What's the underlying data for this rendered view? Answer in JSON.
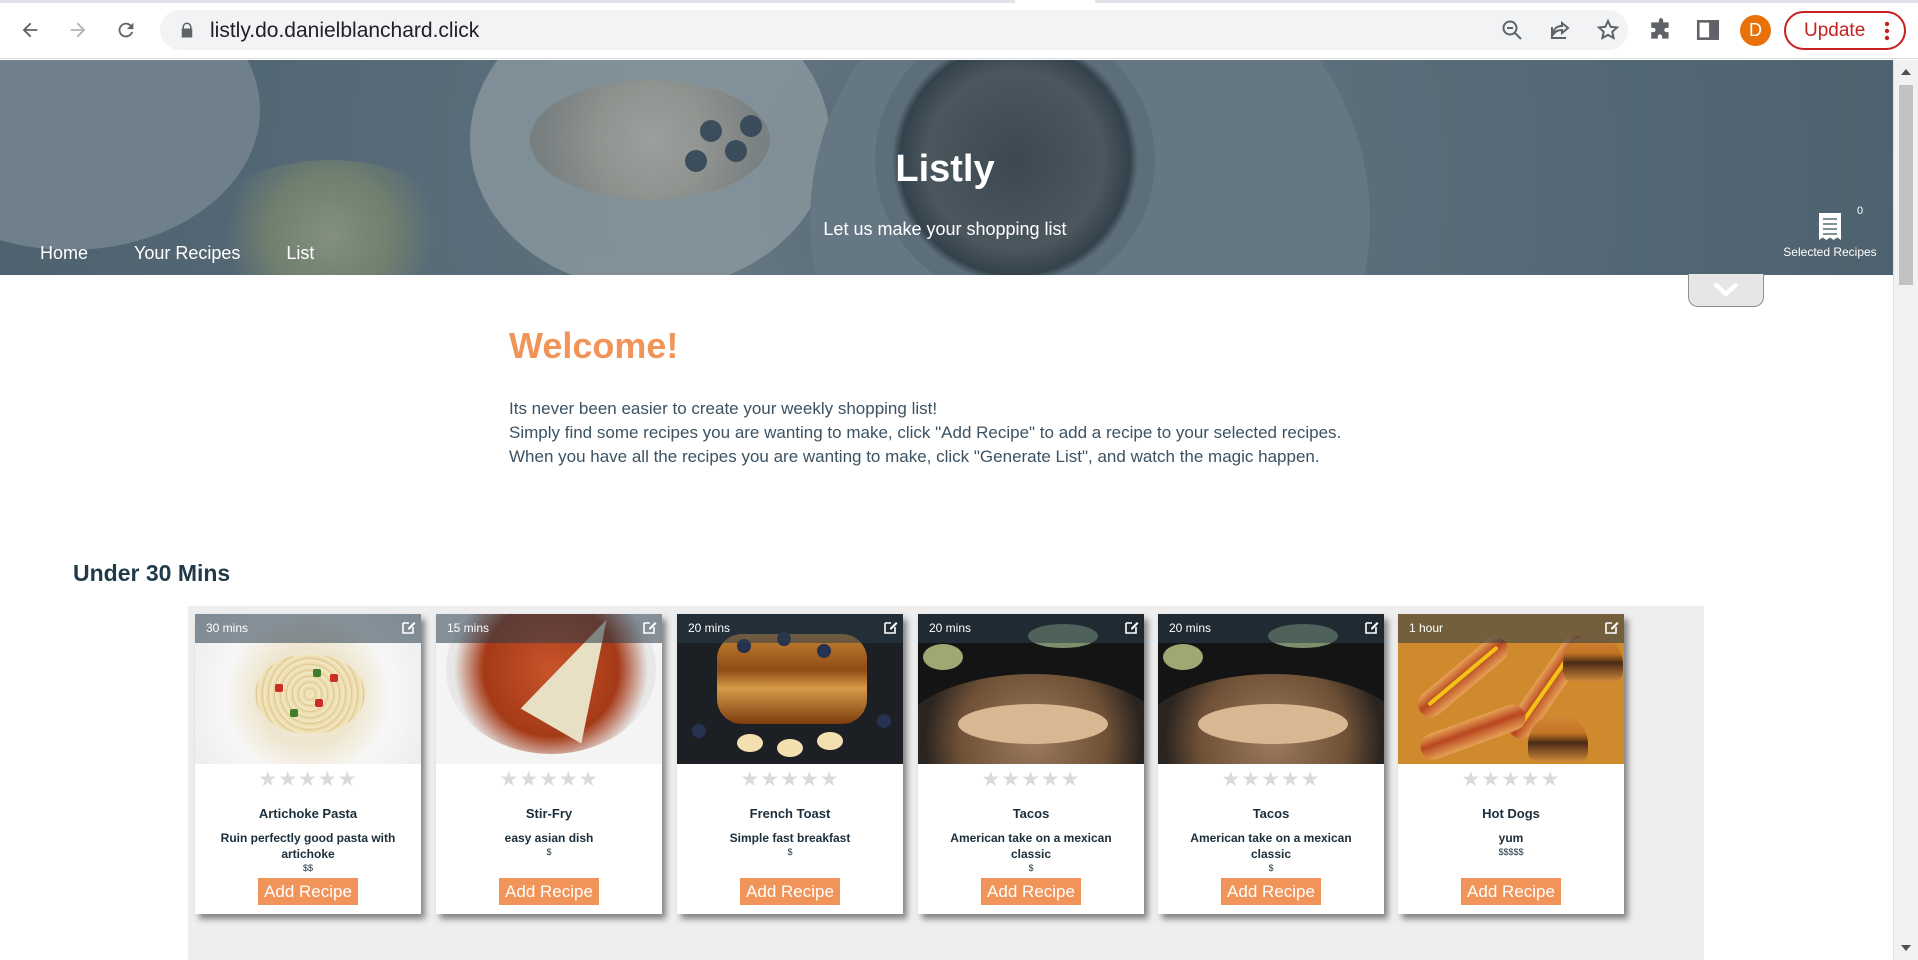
{
  "browser": {
    "url": "listly.do.danielblanchard.click",
    "avatar_letter": "D",
    "update_label": "Update"
  },
  "hero": {
    "title": "Listly",
    "tagline": "Let us make your shopping list",
    "nav": [
      "Home",
      "Your Recipes",
      "List"
    ],
    "selected_count": "0",
    "selected_label": "Selected Recipes"
  },
  "welcome": {
    "heading": "Welcome!",
    "lines": [
      "Its never been easier to create your weekly shopping list!",
      "Simply find some recipes you are wanting to make, click \"Add Recipe\" to add a recipe to your selected recipes.",
      "When you have all the recipes you are wanting to make, click \"Generate List\", and watch the magic happen."
    ]
  },
  "section_title": "Under 30 Mins",
  "stars_text": "★★★★★",
  "add_label": "Add Recipe",
  "cards": [
    {
      "time": "30 mins",
      "name": "Artichoke Pasta",
      "desc": "Ruin perfectly good pasta with artichoke",
      "price": "$$",
      "rating": 0
    },
    {
      "time": "15 mins",
      "name": "Stir-Fry",
      "desc": "easy asian dish",
      "price": "$",
      "rating": 0
    },
    {
      "time": "20 mins",
      "name": "French Toast",
      "desc": "Simple fast breakfast",
      "price": "$",
      "rating": 0
    },
    {
      "time": "20 mins",
      "name": "Tacos",
      "desc": "American take on a mexican classic",
      "price": "$",
      "rating": 0
    },
    {
      "time": "20 mins",
      "name": "Tacos",
      "desc": "American take on a mexican classic",
      "price": "$",
      "rating": 0
    },
    {
      "time": "1 hour",
      "name": "Hot Dogs",
      "desc": "yum",
      "price": "$$$$$",
      "rating": 0
    }
  ],
  "colors": {
    "accent_orange": "#f1945a",
    "text_dark": "#1b2e3a",
    "update_red": "#c5221f"
  }
}
